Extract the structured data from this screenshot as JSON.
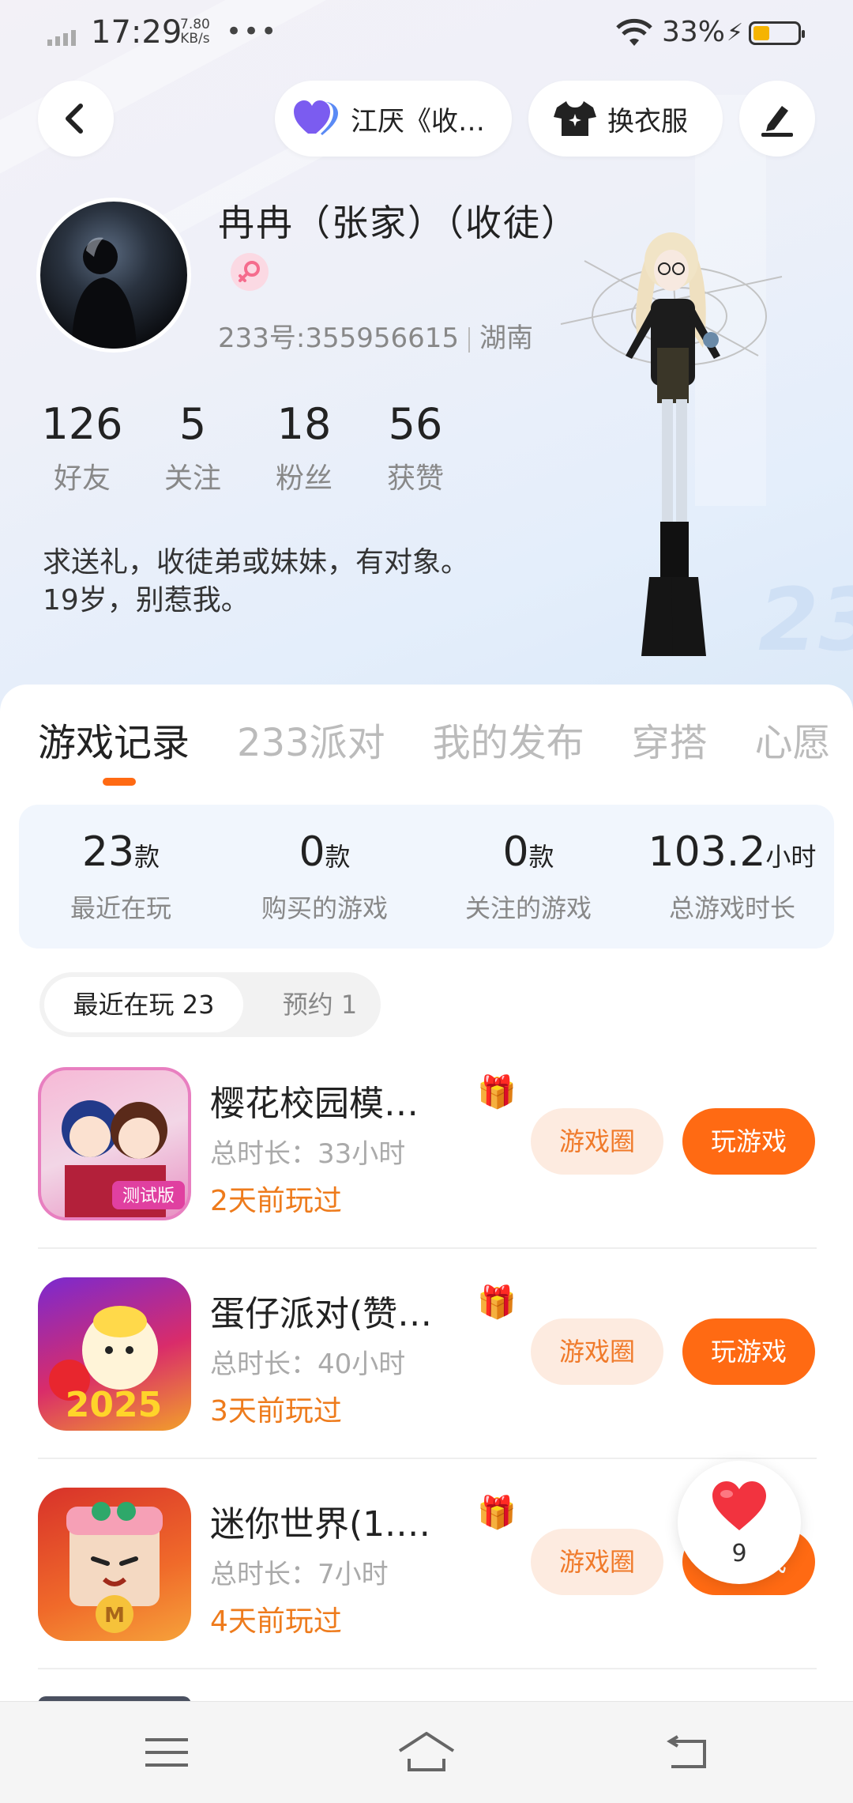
{
  "status_bar": {
    "time": "17:29",
    "net_speed_value": "7.80",
    "net_speed_unit": "KB/s",
    "more": "•••",
    "battery_percent": "33%",
    "battery_level": 0.33
  },
  "top_bar": {
    "guild_label": "江厌《收…",
    "outfit_label": "换衣服"
  },
  "profile": {
    "name": "冉冉（张家）（收徒）",
    "uid_label": "233号:355956615",
    "location": "湖南",
    "bio_line1": "求送礼，收徒弟或妹妹，有对象。",
    "bio_line2": "19岁，别惹我。"
  },
  "stats": [
    {
      "value": "126",
      "label": "好友"
    },
    {
      "value": "5",
      "label": "关注"
    },
    {
      "value": "18",
      "label": "粉丝"
    },
    {
      "value": "56",
      "label": "获赞"
    }
  ],
  "tabs": [
    "游戏记录",
    "233派对",
    "我的发布",
    "穿搭",
    "心愿"
  ],
  "summary": [
    {
      "value": "23",
      "unit": "款",
      "label": "最近在玩"
    },
    {
      "value": "0",
      "unit": "款",
      "label": "购买的游戏"
    },
    {
      "value": "0",
      "unit": "款",
      "label": "关注的游戏"
    },
    {
      "value": "103.2",
      "unit": "小时",
      "label": "总游戏时长"
    }
  ],
  "filters": {
    "recent": "最近在玩 23",
    "reserve": "预约 1"
  },
  "games": [
    {
      "title": "樱花校园模…",
      "duration": "总时长：33小时",
      "last_played": "2天前玩过",
      "circle_btn": "游戏圈",
      "play_btn": "玩游戏",
      "icon_badge": "测试版"
    },
    {
      "title": "蛋仔派对(赞…",
      "duration": "总时长：40小时",
      "last_played": "3天前玩过",
      "circle_btn": "游戏圈",
      "play_btn": "玩游戏",
      "icon_badge": "2025"
    },
    {
      "title": "迷你世界(1.…",
      "duration": "总时长：7小时",
      "last_played": "4天前玩过",
      "circle_btn": "游戏圈",
      "play_btn": "玩游戏",
      "icon_badge": "M"
    }
  ],
  "like_float": {
    "count": "9"
  },
  "colors": {
    "accent": "#ff6a13",
    "accent_light": "#fdebe0",
    "gender_pink": "#f56c8d"
  }
}
